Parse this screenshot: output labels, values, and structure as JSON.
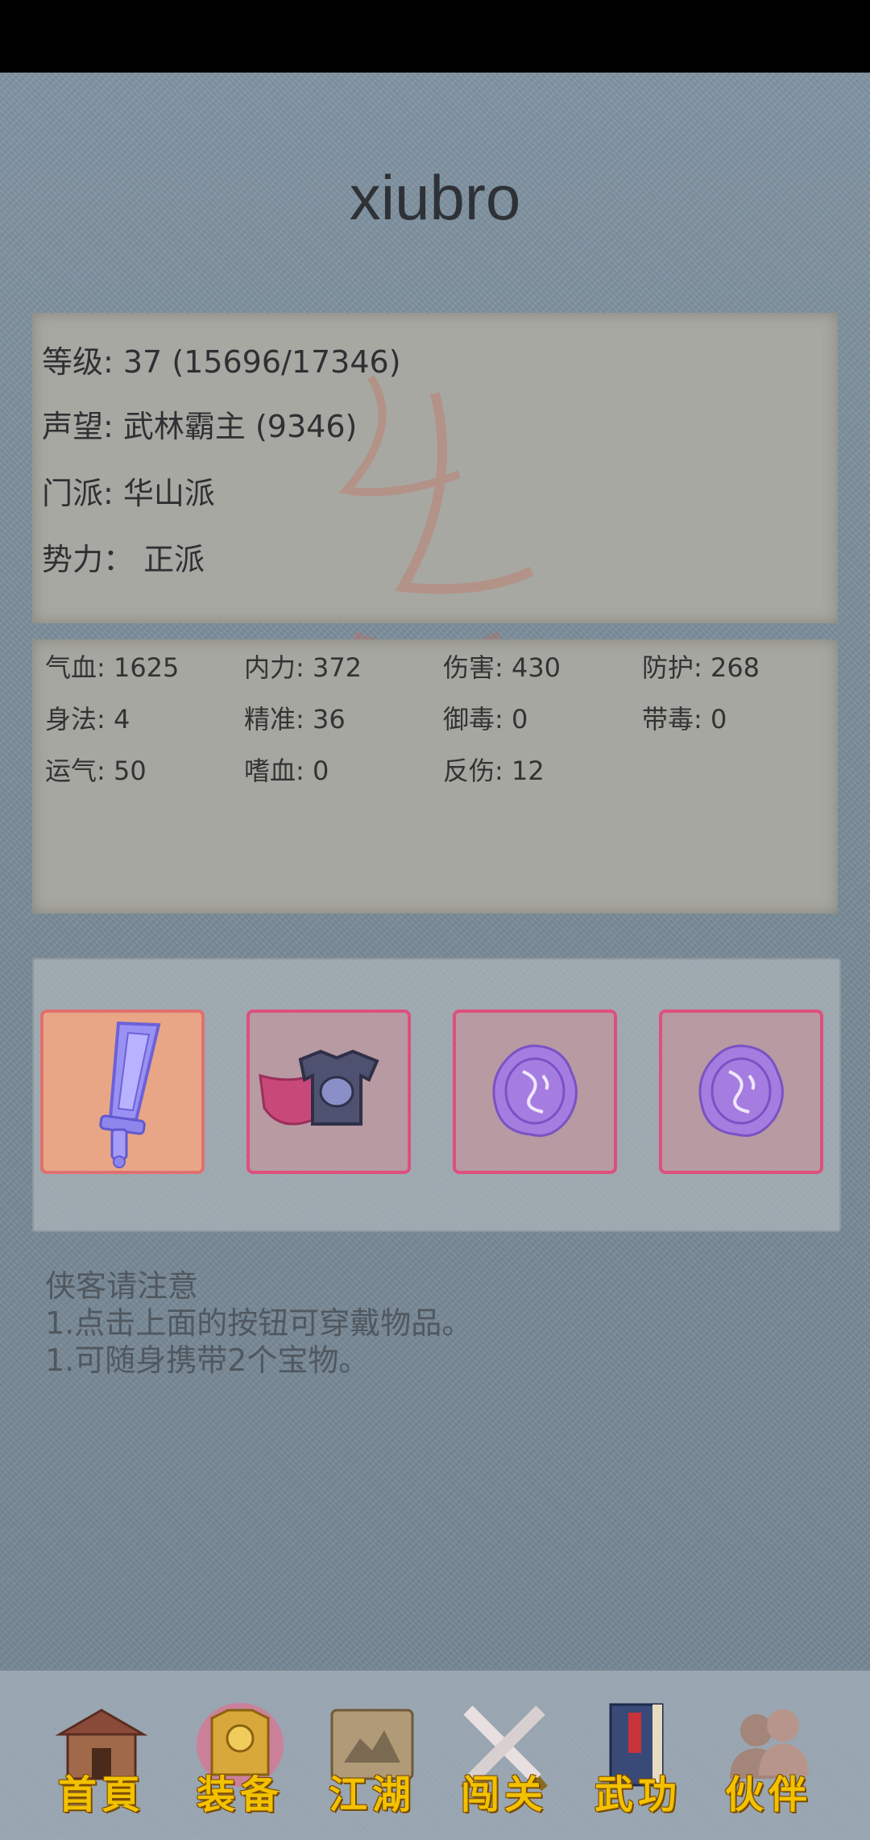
{
  "header": {
    "player_name": "xiubro"
  },
  "info": {
    "level": "等级: 37 (15696/17346)",
    "reputation": "声望: 武林霸主 (9346)",
    "sect": "门派: 华山派",
    "faction": "势力：  正派"
  },
  "stats": [
    [
      "气血: 1625",
      "内力: 372",
      "伤害: 430",
      "防护: 268"
    ],
    [
      "身法: 4",
      "精准: 36",
      "御毒: 0",
      "带毒: 0"
    ],
    [
      "运气: 50",
      "嗜血: 0",
      "反伤: 12",
      ""
    ]
  ],
  "equipment": {
    "slots": [
      {
        "type": "weapon",
        "icon": "sword-icon"
      },
      {
        "type": "armor",
        "icon": "armor-icon"
      },
      {
        "type": "treasure",
        "icon": "purple-seal-icon"
      },
      {
        "type": "treasure",
        "icon": "purple-seal-icon"
      }
    ]
  },
  "notes": {
    "title": "侠客请注意",
    "line1": "1.点击上面的按钮可穿戴物品。",
    "line2": "1.可随身携带2个宝物。"
  },
  "nav": {
    "items": [
      {
        "label": "首頁",
        "icon": "house-icon"
      },
      {
        "label": "装备",
        "icon": "golden-armor-icon"
      },
      {
        "label": "江湖",
        "icon": "map-scroll-icon"
      },
      {
        "label": "闯关",
        "icon": "crossed-swords-icon"
      },
      {
        "label": "武功",
        "icon": "book-icon"
      },
      {
        "label": "伙伴",
        "icon": "companions-icon"
      }
    ]
  },
  "colors": {
    "accent_gold": "#f2c100",
    "slot_border": "#de4f7e",
    "background": "#7d8c99"
  }
}
